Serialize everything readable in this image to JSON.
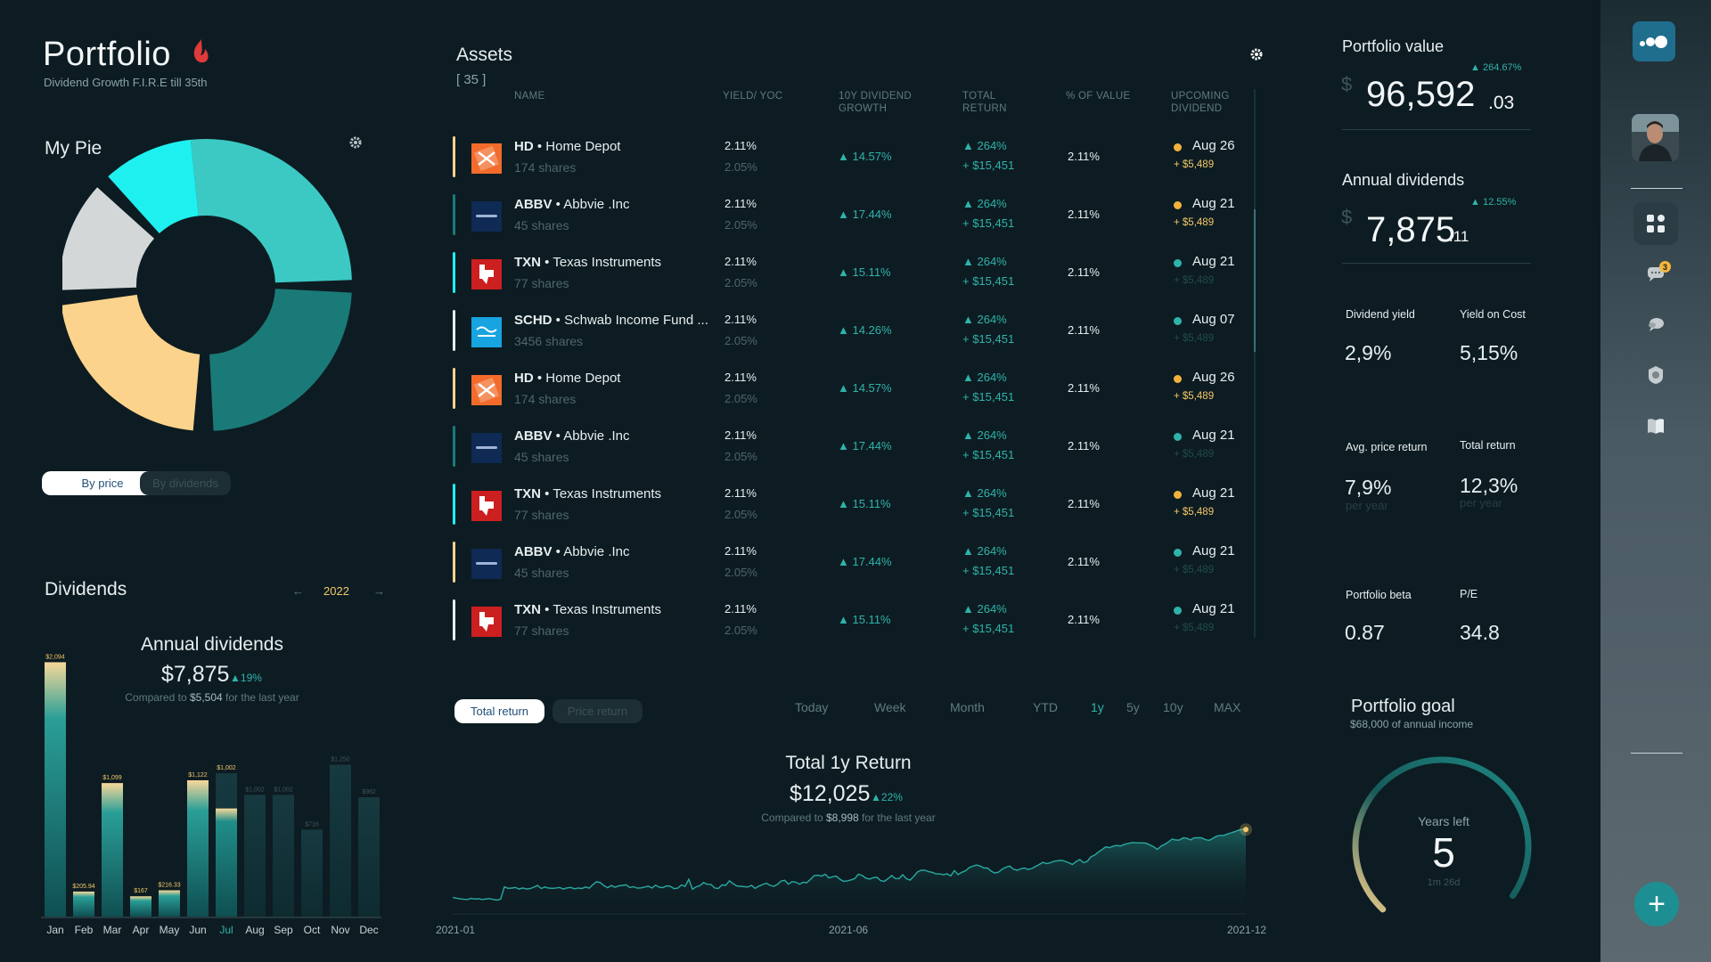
{
  "header": {
    "title": "Portfolio",
    "subtitle": "Dividend Growth F.I.R.E till 35th"
  },
  "pie": {
    "title": "My Pie",
    "toggle": {
      "by_price": "By price",
      "by_dividends": "By dividends",
      "active": "by_price"
    },
    "segments": [
      {
        "name": "teal-light",
        "color": "#3cc9c4"
      },
      {
        "name": "teal-dark",
        "color": "#1a7a78"
      },
      {
        "name": "sand",
        "color": "#fcd38d"
      },
      {
        "name": "grey",
        "color": "#d4d7d8"
      },
      {
        "name": "cyan",
        "color": "#1ef0f0"
      }
    ]
  },
  "dividends": {
    "title": "Dividends",
    "year": "2022",
    "prev": "←",
    "next": "→",
    "annual_title": "Annual dividends",
    "annual_value": "$7,875",
    "annual_delta": "19%",
    "compare_prefix": "Compared to",
    "compare_value": "$5,504",
    "compare_suffix": "for the last year"
  },
  "chart_data": {
    "type": "bar",
    "title": "Annual dividends",
    "categories": [
      "Jan",
      "Feb",
      "Mar",
      "Apr",
      "May",
      "Jun",
      "Jul",
      "Aug",
      "Sep",
      "Oct",
      "Nov",
      "Dec"
    ],
    "series": [
      {
        "name": "paid",
        "values": [
          2094,
          205.94,
          1099,
          167,
          216.33,
          1122,
          1002,
          null,
          null,
          null,
          null,
          null
        ]
      },
      {
        "name": "expected",
        "values": [
          null,
          null,
          null,
          null,
          null,
          null,
          null,
          1002,
          1002,
          716,
          1250,
          982
        ]
      }
    ],
    "value_labels": [
      "$2,094",
      "$205.94",
      "$1,099",
      "$167",
      "$216.33",
      "$1,122",
      "$1,002",
      "$1,002",
      "$1,002",
      "$716",
      "$1,250",
      "$982"
    ],
    "highlight": "Jul",
    "ylim": [
      0,
      2200
    ]
  },
  "assets": {
    "title": "Assets",
    "count": "[ 35 ]",
    "columns": [
      "NAME",
      "YIELD/ YOC",
      "10Y DIVIDEND GROWTH",
      "TOTAL RETURN",
      "% OF VALUE",
      "UPCOMING DIVIDEND"
    ],
    "rows": [
      {
        "ticker": "HD",
        "name": "Home Depot",
        "shares": "174 shares",
        "yield": "2.11%",
        "yoc": "2.05%",
        "growth": "14.57%",
        "total_return": "264%",
        "total_return_amt": "+ $15,451",
        "pct_value": "2.11%",
        "upcoming": "Aug 26",
        "upcoming_amt": "+ $5,489",
        "confirmed": true,
        "accent": "#fcd38d",
        "logo": "hd"
      },
      {
        "ticker": "ABBV",
        "name": "Abbvie .Inc",
        "shares": "45 shares",
        "yield": "2.11%",
        "yoc": "2.05%",
        "growth": "17.44%",
        "total_return": "264%",
        "total_return_amt": "+ $15,451",
        "pct_value": "2.11%",
        "upcoming": "Aug 21",
        "upcoming_amt": "+ $5,489",
        "confirmed": true,
        "accent": "#1a7a78",
        "logo": "abbv"
      },
      {
        "ticker": "TXN",
        "name": "Texas Instruments",
        "shares": "77 shares",
        "yield": "2.11%",
        "yoc": "2.05%",
        "growth": "15.11%",
        "total_return": "264%",
        "total_return_amt": "+ $15,451",
        "pct_value": "2.11%",
        "upcoming": "Aug 21",
        "upcoming_amt": "+ $5,489",
        "confirmed": false,
        "accent": "#1ef0f0",
        "logo": "txn"
      },
      {
        "ticker": "SCHD",
        "name": "Schwab Income Fund ...",
        "shares": "3456 shares",
        "yield": "2.11%",
        "yoc": "2.05%",
        "growth": "14.26%",
        "total_return": "264%",
        "total_return_amt": "+ $15,451",
        "pct_value": "2.11%",
        "upcoming": "Aug 07",
        "upcoming_amt": "+ $5,489",
        "confirmed": false,
        "accent": "#e6eef0",
        "logo": "schd"
      },
      {
        "ticker": "HD",
        "name": "Home Depot",
        "shares": "174 shares",
        "yield": "2.11%",
        "yoc": "2.05%",
        "growth": "14.57%",
        "total_return": "264%",
        "total_return_amt": "+ $15,451",
        "pct_value": "2.11%",
        "upcoming": "Aug 26",
        "upcoming_amt": "+ $5,489",
        "confirmed": true,
        "accent": "#fcd38d",
        "logo": "hd"
      },
      {
        "ticker": "ABBV",
        "name": "Abbvie .Inc",
        "shares": "45 shares",
        "yield": "2.11%",
        "yoc": "2.05%",
        "growth": "17.44%",
        "total_return": "264%",
        "total_return_amt": "+ $15,451",
        "pct_value": "2.11%",
        "upcoming": "Aug 21",
        "upcoming_amt": "+ $5,489",
        "confirmed": false,
        "accent": "#1a7a78",
        "logo": "abbv"
      },
      {
        "ticker": "TXN",
        "name": "Texas Instruments",
        "shares": "77 shares",
        "yield": "2.11%",
        "yoc": "2.05%",
        "growth": "15.11%",
        "total_return": "264%",
        "total_return_amt": "+ $15,451",
        "pct_value": "2.11%",
        "upcoming": "Aug 21",
        "upcoming_amt": "+ $5,489",
        "confirmed": true,
        "accent": "#1ef0f0",
        "logo": "txn"
      },
      {
        "ticker": "ABBV",
        "name": "Abbvie .Inc",
        "shares": "45 shares",
        "yield": "2.11%",
        "yoc": "2.05%",
        "growth": "17.44%",
        "total_return": "264%",
        "total_return_amt": "+ $15,451",
        "pct_value": "2.11%",
        "upcoming": "Aug 21",
        "upcoming_amt": "+ $5,489",
        "confirmed": false,
        "accent": "#fcd38d",
        "logo": "abbv"
      },
      {
        "ticker": "TXN",
        "name": "Texas Instruments",
        "shares": "77 shares",
        "yield": "2.11%",
        "yoc": "2.05%",
        "growth": "15.11%",
        "total_return": "264%",
        "total_return_amt": "+ $15,451",
        "pct_value": "2.11%",
        "upcoming": "Aug 21",
        "upcoming_amt": "+ $5,489",
        "confirmed": false,
        "accent": "#e6eef0",
        "logo": "txn"
      }
    ]
  },
  "returns": {
    "toggle": {
      "total": "Total return",
      "price": "Price return"
    },
    "periods": [
      "Today",
      "Week",
      "Month",
      "YTD",
      "1y",
      "5y",
      "10y",
      "MAX"
    ],
    "active_period": "1y",
    "title": "Total 1y Return",
    "value": "$12,025",
    "delta": "22%",
    "compare_prefix": "Compared to",
    "compare_value": "$8,998",
    "compare_suffix": "for the last year",
    "x_labels": [
      "2021-01",
      "2021-06",
      "2021-12"
    ],
    "series": [
      10.0,
      9.4,
      8.7,
      8.3,
      8.2,
      9.1,
      8.6,
      8.8,
      8.2,
      8.6,
      9.0,
      8.2,
      7.6,
      8.5,
      19.5,
      18.2,
      18.4,
      19.0,
      17.5,
      18.5,
      17.6,
      17.9,
      19.2,
      20.8,
      18.0,
      19.4,
      18.4,
      18.2,
      18.5,
      19.0,
      17.5,
      18.6,
      19.0,
      17.8,
      18.5,
      18.0,
      19.4,
      18.3,
      21.5,
      24.1,
      23.4,
      20.6,
      18.7,
      20.7,
      19.1,
      20.3,
      20.8,
      21.3,
      18.9,
      19.6,
      18.3,
      18.6,
      19.2,
      20.1,
      18.5,
      21.0,
      19.1,
      18.8,
      20.4,
      20.0,
      17.9,
      18.3,
      21.2,
      19.9,
      26.3,
      17.4,
      19.5,
      20.5,
      23.4,
      21.8,
      21.7,
      18.5,
      18.0,
      21.3,
      20.8,
      25.0,
      22.4,
      20.3,
      20.0,
      19.7,
      19.4,
      20.9,
      18.2,
      20.2,
      21.5,
      22.8,
      20.9,
      20.0,
      21.6,
      24.7,
      25.4,
      21.9,
      24.2,
      23.7,
      21.9,
      23.6,
      23.3,
      26.2,
      29.6,
      29.9,
      29.2,
      30.8,
      27.5,
      28.6,
      29.1,
      26.2,
      24.4,
      24.9,
      25.8,
      27.0,
      30.9,
      29.7,
      27.4,
      26.5,
      27.8,
      28.1,
      25.1,
      24.4,
      26.8,
      29.7,
      27.0,
      26.9,
      30.4,
      26.8,
      25.5,
      29.0,
      32.9,
      34.4,
      34.5,
      33.1,
      32.6,
      31.1,
      31.1,
      30.4,
      31.3,
      29.4,
      34.1,
      30.6,
      32.6,
      33.9,
      36.7,
      38.1,
      39.1,
      38.2,
      36.5,
      36.4,
      33.5,
      31.9,
      32.8,
      35.5,
      37.2,
      38.2,
      35.4,
      34.4,
      35.7,
      36.4,
      35.1,
      36.0,
      37.8,
      39.6,
      41.5,
      40.4,
      41.1,
      42.5,
      43.0,
      43.4,
      42.4,
      41.2,
      39.6,
      42.2,
      44.0,
      41.2,
      42.3,
      46.5,
      48.0,
      50.6,
      53.0,
      55.4,
      54.7,
      55.9,
      56.7,
      56.2,
      57.5,
      58.4,
      59.2,
      59.1,
      59.0,
      59.0,
      58.7,
      57.1,
      55.5,
      53.1,
      56.0,
      57.7,
      59.8,
      62.4,
      61.5,
      61.6,
      63.5,
      63.2,
      61.6,
      63.5,
      63.6,
      63.5,
      62.0,
      61.2,
      62.9,
      65.0,
      65.7,
      65.7,
      67.0,
      68.0,
      69.1,
      70.3,
      71.3,
      71.0
    ]
  },
  "stats": {
    "portfolio_value": {
      "title": "Portfolio value",
      "currency": "$",
      "value": "96,592",
      "cents": ".03",
      "delta": "264.67%"
    },
    "annual_dividends": {
      "title": "Annual dividends",
      "currency": "$",
      "value": "7,875",
      "cents": ".11",
      "delta": "12.55%"
    },
    "dividend_yield": {
      "label": "Dividend yield",
      "value": "2,9%"
    },
    "yield_on_cost": {
      "label": "Yield on Cost",
      "value": "5,15%"
    },
    "avg_price_return": {
      "label": "Avg. price return",
      "value": "7,9%",
      "sub": "per year"
    },
    "total_return": {
      "label": "Total return",
      "value": "12,3%",
      "sub": "per year"
    },
    "portfolio_beta": {
      "label": "Portfolio beta",
      "value": "0.87"
    },
    "pe": {
      "label": "P/E",
      "value": "34.8"
    }
  },
  "goal": {
    "title": "Portfolio goal",
    "subtitle": "$68,000 of annual income",
    "label": "Years left",
    "value": "5",
    "rest": "1m 26d",
    "progress": 0.55
  },
  "sidebar": {
    "notification_count": "3",
    "add": "+"
  }
}
